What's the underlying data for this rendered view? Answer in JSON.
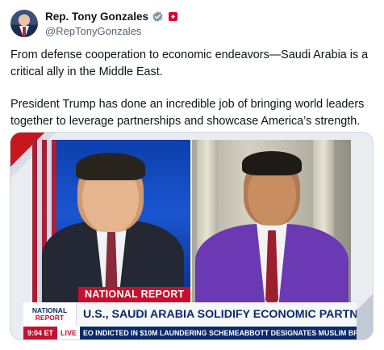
{
  "author": {
    "display_name": "Rep. Tony Gonzales",
    "handle": "@RepTonyGonzales",
    "verified_icon": "verified-badge-icon",
    "affiliation_icon": "government-flag-icon"
  },
  "tweet": {
    "paragraph_1": "From defense cooperation to economic endeavors—Saudi Arabia is a critical ally in the Middle East.",
    "paragraph_2": "President Trump has done an incredible job of bringing world leaders together to leverage partnerships and showcase America’s strength."
  },
  "video": {
    "segment_label": "NATIONAL REPORT",
    "logo_line_1": "NATIONAL",
    "logo_line_2": "REPORT",
    "headline": "U.S., SAUDI ARABIA SOLIDIFY ECONOMIC PARTNERSHIP",
    "time": "9:04 ET",
    "live_label": "LIVE",
    "ticker_item_1": "EO INDICTED IN $10M LAUNDERING SCHEME",
    "ticker_item_2": "ABBOTT DESIGNATES MUSLIM BROTHERHOO"
  },
  "colors": {
    "accent_red": "#c8102e",
    "navy": "#0b2a6b",
    "guest_suit": "#6b39b3",
    "text": "#0f1419",
    "muted": "#536471"
  }
}
